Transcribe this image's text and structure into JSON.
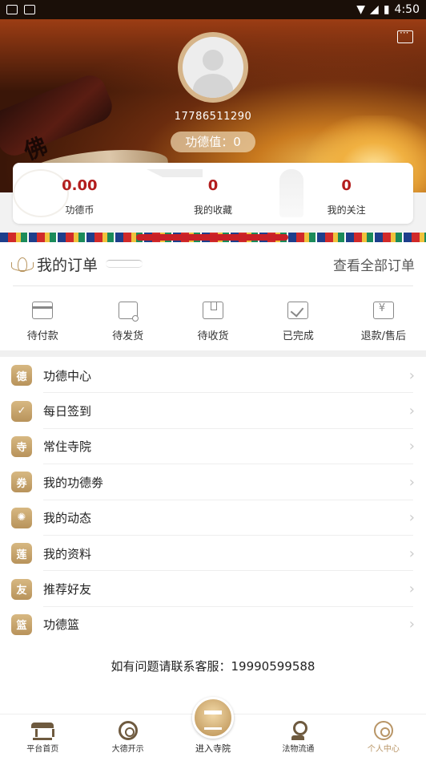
{
  "status_bar": {
    "time": "4:50"
  },
  "profile": {
    "phone": "17786511290",
    "merit_label": "功德值：0"
  },
  "stats": [
    {
      "value": "0.00",
      "label": "功德币"
    },
    {
      "value": "0",
      "label": "我的收藏"
    },
    {
      "value": "0",
      "label": "我的关注"
    }
  ],
  "orders": {
    "title": "我的订单",
    "view_all": "查看全部订单",
    "items": [
      {
        "label": "待付款",
        "icon": "card-icon"
      },
      {
        "label": "待发货",
        "icon": "truck-icon"
      },
      {
        "label": "待收货",
        "icon": "box-icon"
      },
      {
        "label": "已完成",
        "icon": "check-icon"
      },
      {
        "label": "退款/售后",
        "icon": "refund-icon"
      }
    ]
  },
  "menu": [
    {
      "label": "功德中心",
      "icon_char": "德"
    },
    {
      "label": "每日签到",
      "icon_char": "✓"
    },
    {
      "label": "常住寺院",
      "icon_char": "寺"
    },
    {
      "label": "我的功德劵",
      "icon_char": "券"
    },
    {
      "label": "我的动态",
      "icon_char": "✺"
    },
    {
      "label": "我的资料",
      "icon_char": "莲"
    },
    {
      "label": "推荐好友",
      "icon_char": "友"
    },
    {
      "label": "功德篮",
      "icon_char": "篮"
    }
  ],
  "contact": "如有问题请联系客服：19990599588",
  "tabs": [
    {
      "label": "平台首页"
    },
    {
      "label": "大德开示"
    },
    {
      "label": "进入寺院"
    },
    {
      "label": "法物流通"
    },
    {
      "label": "个人中心"
    }
  ],
  "colors": {
    "accent_red": "#b31d1d",
    "gold": "#b89566"
  }
}
